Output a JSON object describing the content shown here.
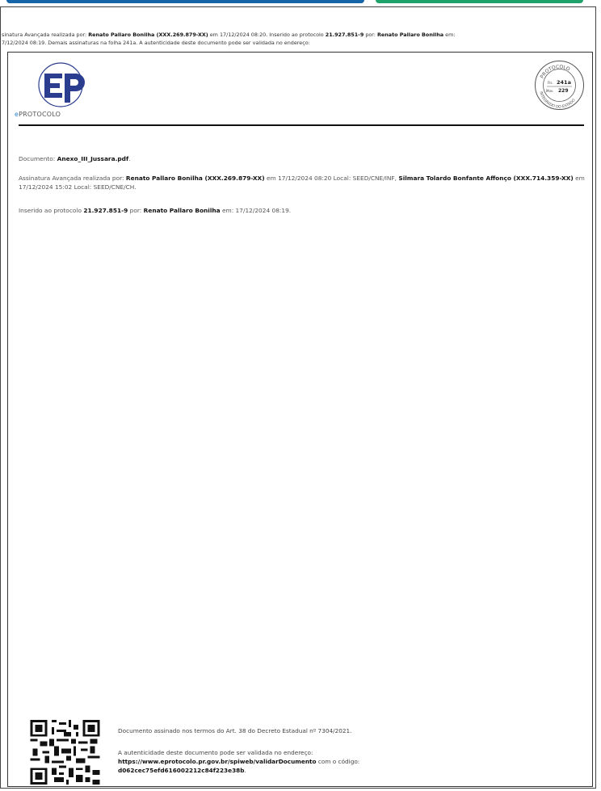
{
  "header": {
    "line1_a": "sinatura Avançada realizada por: ",
    "line1_name": "Renato Pallaro Bonilha (XXX.269.879-XX)",
    "line1_b": " em 17/12/2024 08:20. Inserido ao protocolo ",
    "line1_proto": "21.927.851-9",
    "line1_c": " por: ",
    "line1_name2": "Renato Pallaro Bonilha",
    "line1_d": " em:",
    "line2": "7/12/2024 08:19.  Demais assinaturas na folha 241a. A autenticidade deste documento pode ser validada no endereço:"
  },
  "logo": {
    "mark": "ep",
    "text_e": "e",
    "text_rest": "PROTOCOLO"
  },
  "stamp": {
    "top": "PROTOCOLO",
    "bottom": "INTEGRADO DO ESTADO",
    "fl_label": "Fls.",
    "fl_value": "241a",
    "mov_label": "Mov.",
    "mov_value": "229"
  },
  "doc": {
    "label": "Documento: ",
    "filename": "Anexo_III_Jussara.pdf",
    "filename_end": "."
  },
  "sig": {
    "a": "Assinatura Avançada realizada por: ",
    "name1": "Renato Pallaro Bonilha (XXX.269.879-XX)",
    "b": " em 17/12/2024 08:20 Local: SEED/CNE/INF, ",
    "name2": "Silmara Tolardo Bonfante Affonço (XXX.714.359-XX)",
    "c": " em 17/12/2024 15:02 Local: SEED/CNE/CH."
  },
  "ins": {
    "a": "Inserido ao protocolo ",
    "proto": "21.927.851-9",
    "b": " por: ",
    "name": "Renato Pallaro Bonilha",
    "c": " em: 17/12/2024 08:19."
  },
  "footer": {
    "f1": "Documento assinado nos termos do Art. 38 do Decreto Estadual nº 7304/2021.",
    "f2": "A autenticidade deste documento pode ser validada no endereço:",
    "url": "https://www.eprotocolo.pr.gov.br/spiweb/validarDocumento",
    "f3b": " com o código:",
    "code": "d062cec75efd616002212c84f223e38b",
    "code_end": "."
  }
}
